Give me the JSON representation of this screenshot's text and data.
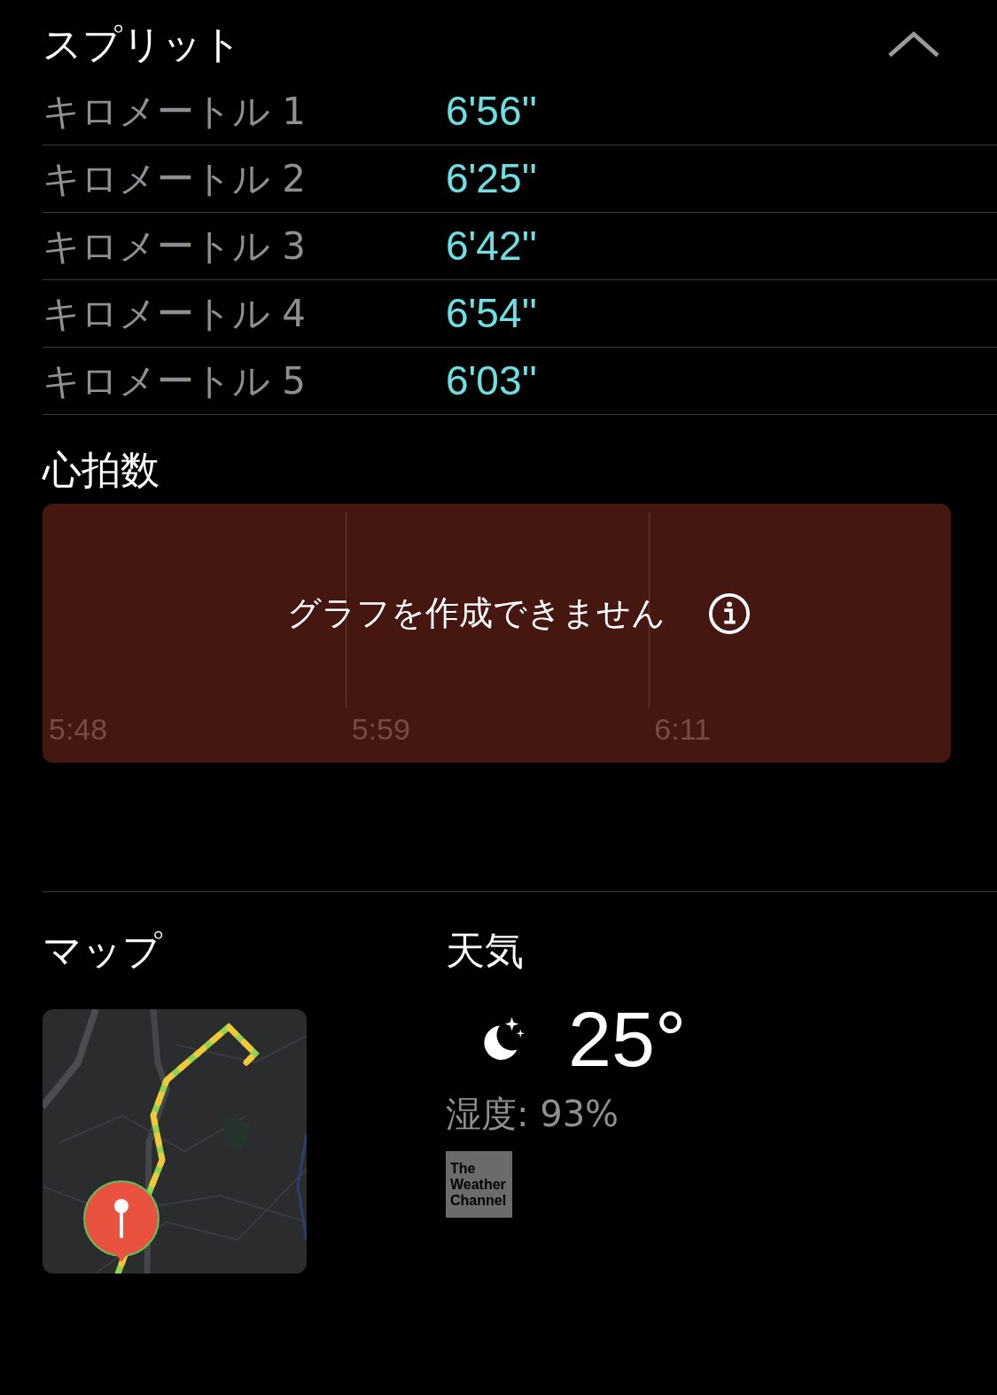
{
  "splits": {
    "title": "スプリット",
    "expanded": true,
    "rows": [
      {
        "label": "キロメートル 1",
        "pace": "6'56''"
      },
      {
        "label": "キロメートル 2",
        "pace": "6'25''"
      },
      {
        "label": "キロメートル 3",
        "pace": "6'42''"
      },
      {
        "label": "キロメートル 4",
        "pace": "6'54''"
      },
      {
        "label": "キロメートル 5",
        "pace": "6'03''"
      }
    ]
  },
  "heart_rate": {
    "title": "心拍数",
    "message": "グラフを作成できません",
    "time_labels": [
      "5:48",
      "5:59",
      "6:11"
    ]
  },
  "map": {
    "title": "マップ"
  },
  "weather": {
    "title": "天気",
    "temperature": "25°",
    "humidity": "湿度: 93%",
    "logo_lines": [
      "The",
      "Weather",
      "Channel"
    ]
  }
}
